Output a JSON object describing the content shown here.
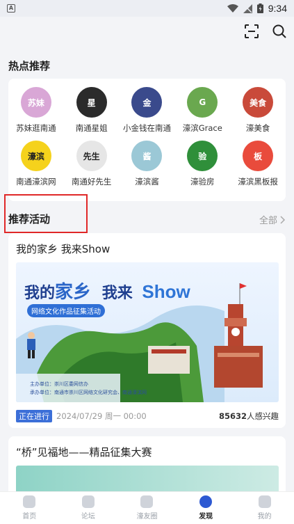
{
  "status_bar": {
    "time": "9:34",
    "badge": "A"
  },
  "header": {
    "icons": [
      "scan-icon",
      "search-icon"
    ]
  },
  "hot": {
    "title": "热点推荐",
    "items": [
      {
        "label": "苏妹逛南通",
        "avatar_text": "苏妹",
        "color": "#d9a7d6"
      },
      {
        "label": "南通星姐",
        "avatar_text": "星",
        "color": "#2b2b2b"
      },
      {
        "label": "小金钱在南通",
        "avatar_text": "金",
        "color": "#3a4a8c"
      },
      {
        "label": "濠滨Grace",
        "avatar_text": "G",
        "color": "#6aa84f"
      },
      {
        "label": "濠美食",
        "avatar_text": "美食",
        "color": "#c94a3a"
      },
      {
        "label": "南通濠滨网",
        "avatar_text": "濠滨",
        "color": "#f5d21c"
      },
      {
        "label": "南通好先生",
        "avatar_text": "先生",
        "color": "#e6e6e6"
      },
      {
        "label": "濠滨酱",
        "avatar_text": "酱",
        "color": "#9bc8d6"
      },
      {
        "label": "濠验房",
        "avatar_text": "验",
        "color": "#2f8f3a"
      },
      {
        "label": "濠滨黑板报",
        "avatar_text": "板",
        "color": "#e94b3c"
      }
    ]
  },
  "activities": {
    "title": "推荐活动",
    "all_label": "全部",
    "items": [
      {
        "title": "我的家乡 我来Show",
        "banner": {
          "headline_a": "我的",
          "headline_b": "家乡",
          "headline_c": "我来",
          "headline_d": "Show",
          "subtitle": "网络文化作品征集活动",
          "host": "主办单位：崇川区委网信办",
          "organizer": "承办单位：南通市崇川区网络文化研究会、南通濠滨网"
        },
        "status": "正在进行",
        "date": "2024/07/29 周一 00:00",
        "interest_count": "85632",
        "interest_suffix": "人感兴趣"
      },
      {
        "title": "“桥”见福地——精品征集大赛"
      }
    ]
  },
  "nav": {
    "items": [
      {
        "label": "首页"
      },
      {
        "label": "论坛"
      },
      {
        "label": "濠友圈"
      },
      {
        "label": "发现"
      },
      {
        "label": "我的"
      }
    ]
  }
}
